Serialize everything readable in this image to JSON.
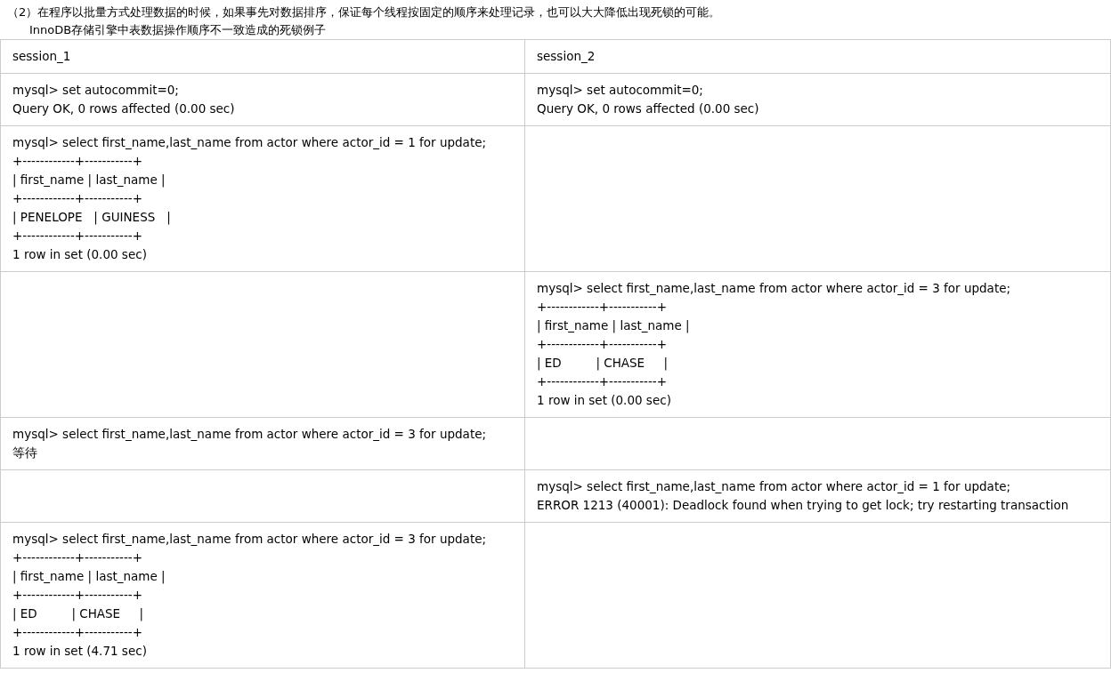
{
  "intro": [
    "（2）在程序以批量方式处理数据的时候，如果事先对数据排序，保证每个线程按固定的顺序来处理记录，也可以大大降低出现死锁的可能。",
    "InnoDB存储引擎中表数据操作顺序不一致造成的死锁例子"
  ],
  "table": {
    "columns": [
      "session_1",
      "session_2"
    ],
    "rows": [
      {
        "cells": [
          {
            "lines": [
              "mysql> set autocommit=0;",
              "Query OK, 0 rows affected (0.00 sec)"
            ]
          },
          {
            "lines": [
              "mysql> set autocommit=0;",
              "Query OK, 0 rows affected (0.00 sec)"
            ]
          }
        ]
      },
      {
        "cells": [
          {
            "lines": [
              "mysql> select first_name,last_name from actor where actor_id = 1 for update;",
              "+------------+-----------+",
              "| first_name | last_name |",
              "+------------+-----------+",
              "| PENELOPE   | GUINESS   |",
              "+------------+-----------+",
              "1 row in set (0.00 sec)"
            ]
          },
          {}
        ]
      },
      {
        "cells": [
          {},
          {
            "lines": [
              "mysql> select first_name,last_name from actor where actor_id = 3 for update;",
              "+------------+-----------+",
              "| first_name | last_name |",
              "+------------+-----------+",
              "| ED         | CHASE     |",
              "+------------+-----------+",
              "1 row in set (0.00 sec)"
            ]
          }
        ]
      },
      {
        "cells": [
          {
            "lines": [
              "mysql> select first_name,last_name from actor where actor_id = 3 for update;",
              "等待"
            ]
          },
          {}
        ]
      },
      {
        "cells": [
          {},
          {
            "lines": [
              "mysql> select first_name,last_name from actor where actor_id = 1 for update;",
              "ERROR 1213 (40001): Deadlock found when trying to get lock; try restarting transaction"
            ]
          }
        ]
      },
      {
        "cells": [
          {
            "lines": [
              "mysql> select first_name,last_name from actor where actor_id = 3 for update;",
              "+------------+-----------+",
              "| first_name | last_name |",
              "+------------+-----------+",
              "| ED         | CHASE     |",
              "+------------+-----------+",
              "1 row in set (4.71 sec)"
            ]
          },
          {}
        ]
      }
    ]
  }
}
